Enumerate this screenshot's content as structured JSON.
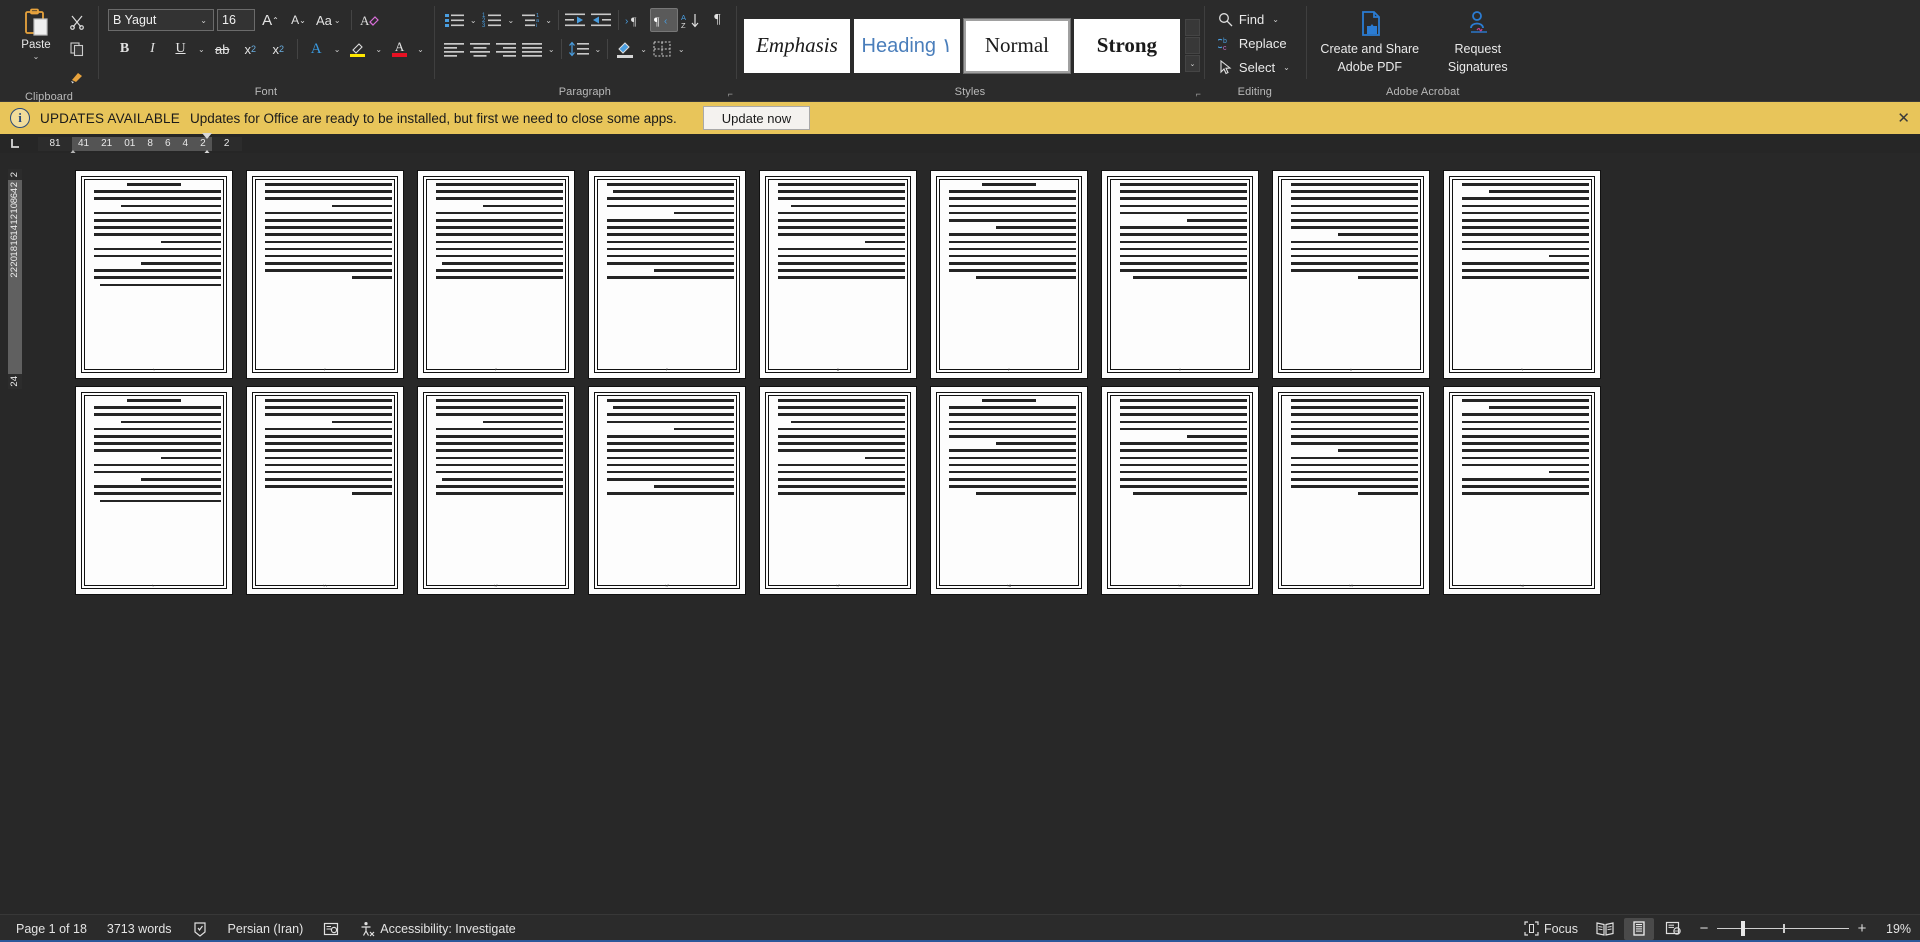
{
  "ribbon": {
    "groups": [
      {
        "id": "clipboard",
        "label": "Clipboard"
      },
      {
        "id": "font",
        "label": "Font"
      },
      {
        "id": "paragraph",
        "label": "Paragraph"
      },
      {
        "id": "styles",
        "label": "Styles"
      },
      {
        "id": "editing",
        "label": "Editing"
      },
      {
        "id": "acrobat",
        "label": "Adobe Acrobat"
      }
    ],
    "clipboard": {
      "paste_label": "Paste",
      "paste_caret": "⌄",
      "cut_icon": "scissors-icon",
      "copy_icon": "copy-icon",
      "format_painter_icon": "format-painter-icon"
    },
    "font": {
      "font_name": "B Yagut",
      "font_size": "16",
      "grow_font": "A",
      "shrink_font": "A",
      "change_case": "Aa",
      "clear_formatting": "clear-formatting-icon",
      "bold": "B",
      "italic": "I",
      "underline": "U",
      "strikethrough": "ab",
      "subscript": "x",
      "subscript_sub": "2",
      "superscript": "x",
      "superscript_sup": "2",
      "text_effects": "A",
      "highlight": "highlight-icon",
      "font_color": "A",
      "highlight_color": "#ffe600",
      "font_color_value": "#e81123",
      "text_effect_color": "#2f9fe0"
    },
    "paragraph": {
      "bullets": "bullets-icon",
      "numbering": "numbering-icon",
      "multilevel": "multilevel-list-icon",
      "decrease_indent": "decrease-indent-icon",
      "increase_indent": "increase-indent-icon",
      "ltr_text": "ltr-text-direction-icon",
      "rtl_text": "rtl-text-direction-icon",
      "sort": "sort-icon",
      "show_marks": "¶",
      "align_left": "align-left-icon",
      "align_center": "align-center-icon",
      "align_right": "align-right-icon",
      "justify": "justify-icon",
      "line_spacing": "line-spacing-icon",
      "shading": "shading-icon",
      "borders": "borders-icon",
      "rtl_active": true
    },
    "styles": {
      "items": [
        {
          "name": "Emphasis",
          "label": "Emphasis",
          "selected": false
        },
        {
          "name": "Heading 1",
          "label": "Heading ۱",
          "selected": false
        },
        {
          "name": "Normal",
          "label": "Normal",
          "selected": true
        },
        {
          "name": "Strong",
          "label": "Strong",
          "selected": false
        }
      ],
      "scroll_up": "⌃",
      "scroll_down": "⌄",
      "more": "⌄"
    },
    "editing": {
      "find": "Find",
      "find_caret": "⌄",
      "replace": "Replace",
      "select": "Select",
      "select_caret": "⌄"
    },
    "acrobat": {
      "create_share_pdf": "Create and Share\nAdobe PDF",
      "create_share_pdf_line1": "Create and Share",
      "create_share_pdf_line2": "Adobe PDF",
      "request_signatures_line1": "Request",
      "request_signatures_line2": "Signatures"
    }
  },
  "notification": {
    "icon": "info-icon",
    "badge": "UPDATES AVAILABLE",
    "message": "Updates for Office are ready to be installed, but first we need to close some apps.",
    "button": "Update now",
    "close": "✕",
    "background": "#e8c55a"
  },
  "rulers": {
    "corner_icon": "tab-stop-left-icon",
    "horizontal": [
      "81",
      "41",
      "21",
      "01",
      "8",
      "6",
      "4",
      "2",
      "2"
    ],
    "vertical_top": "2",
    "vertical": [
      "2",
      "4",
      "6",
      "8",
      "10",
      "12",
      "14",
      "16",
      "18",
      "20",
      "22"
    ],
    "vertical_bottom": "24"
  },
  "document": {
    "pages_visible": 18,
    "columns": 9,
    "rows": 2,
    "page_numbers": [
      "۱",
      "۲",
      "۳",
      "۴",
      "۵",
      "۶",
      "۷",
      "۸",
      "۹",
      "۱۰",
      "۱۱",
      "۱۲",
      "۱۳",
      "۱۴",
      "۱۵",
      "۱۶",
      "۱۷",
      "۱۸"
    ],
    "direction": "rtl",
    "language": "Persian",
    "lines_per_page": [
      [
        "center",
        "95",
        "95",
        "75",
        "95",
        "95",
        "95",
        "95",
        "45",
        "95",
        "95",
        "60",
        "95",
        "95",
        "90"
      ],
      [
        "95",
        "95",
        "95",
        "45",
        "95",
        "95",
        "95",
        "95",
        "95",
        "95",
        "95",
        "95",
        "95",
        "30"
      ],
      [
        "95",
        "95",
        "95",
        "60",
        "95",
        "95",
        "95",
        "95",
        "95",
        "95",
        "95",
        "90",
        "95",
        "95"
      ],
      [
        "95",
        "90",
        "95",
        "95",
        "45",
        "95",
        "95",
        "95",
        "95",
        "95",
        "95",
        "95",
        "60",
        "95"
      ],
      [
        "95",
        "95",
        "95",
        "85",
        "95",
        "95",
        "95",
        "95",
        "30",
        "95",
        "95",
        "95",
        "95",
        "95"
      ],
      [
        "center",
        "95",
        "95",
        "95",
        "95",
        "95",
        "60",
        "95",
        "95",
        "95",
        "95",
        "95",
        "95",
        "75"
      ],
      [
        "95",
        "95",
        "95",
        "95",
        "95",
        "45",
        "95",
        "95",
        "95",
        "95",
        "95",
        "95",
        "95",
        "85"
      ],
      [
        "95",
        "95",
        "95",
        "95",
        "95",
        "95",
        "95",
        "60",
        "95",
        "95",
        "95",
        "95",
        "95",
        "45"
      ],
      [
        "95",
        "75",
        "95",
        "95",
        "95",
        "95",
        "95",
        "95",
        "95",
        "95",
        "30",
        "95",
        "95",
        "95"
      ]
    ]
  },
  "statusbar": {
    "page_info": "Page 1 of 18",
    "word_count": "3713 words",
    "proofing_icon": "proofing-errors-icon",
    "language": "Persian (Iran)",
    "display_settings_icon": "display-settings-icon",
    "accessibility_icon": "accessibility-icon",
    "accessibility": "Accessibility: Investigate",
    "focus_icon": "focus-icon",
    "focus": "Focus",
    "read_mode_icon": "read-mode-icon",
    "print_layout_icon": "print-layout-icon",
    "web_layout_icon": "web-layout-icon",
    "zoom_out": "−",
    "zoom_in": "+",
    "zoom_level": "19%",
    "active_view": "print-layout"
  }
}
